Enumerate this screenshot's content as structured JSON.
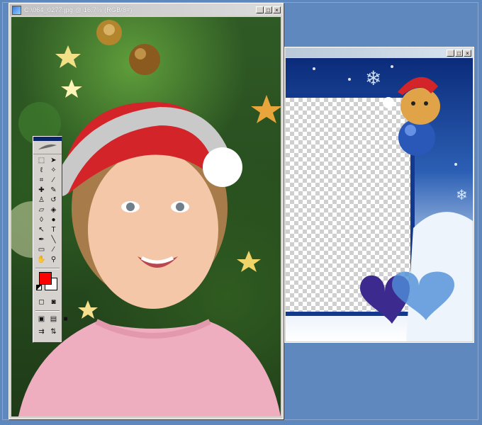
{
  "photo_window": {
    "title": "C:\\064_0277.jpg @ 16.7% (RGB/8#)",
    "buttons": {
      "minimize": "_",
      "maximize": "□",
      "close": "×"
    }
  },
  "frame_window": {
    "buttons": {
      "minimize": "_",
      "maximize": "□",
      "close": "×"
    }
  },
  "toolbox": {
    "tools": [
      {
        "name": "marquee-tool",
        "glyph": "⬚"
      },
      {
        "name": "move-tool",
        "glyph": "➤"
      },
      {
        "name": "lasso-tool",
        "glyph": "ℓ"
      },
      {
        "name": "magic-wand-tool",
        "glyph": "✧"
      },
      {
        "name": "crop-tool",
        "glyph": "⌗"
      },
      {
        "name": "slice-tool",
        "glyph": "∕"
      },
      {
        "name": "healing-brush-tool",
        "glyph": "✚"
      },
      {
        "name": "brush-tool",
        "glyph": "✎"
      },
      {
        "name": "clone-stamp-tool",
        "glyph": "♙"
      },
      {
        "name": "history-brush-tool",
        "glyph": "↺"
      },
      {
        "name": "eraser-tool",
        "glyph": "▱"
      },
      {
        "name": "paint-bucket-tool",
        "glyph": "◈"
      },
      {
        "name": "blur-tool",
        "glyph": "◊"
      },
      {
        "name": "dodge-tool",
        "glyph": "●"
      },
      {
        "name": "path-selection-tool",
        "glyph": "↖"
      },
      {
        "name": "type-tool",
        "glyph": "T"
      },
      {
        "name": "pen-tool",
        "glyph": "✒"
      },
      {
        "name": "line-tool",
        "glyph": "╲"
      },
      {
        "name": "notes-tool",
        "glyph": "▭"
      },
      {
        "name": "eyedropper-tool",
        "glyph": "⁄"
      },
      {
        "name": "hand-tool",
        "glyph": "✋"
      },
      {
        "name": "zoom-tool",
        "glyph": "⚲"
      }
    ],
    "mode_tools": [
      {
        "name": "standard-mode",
        "glyph": "◻"
      },
      {
        "name": "quick-mask-mode",
        "glyph": "◙"
      }
    ],
    "screen_tools": [
      {
        "name": "standard-screen-mode",
        "glyph": "▣"
      },
      {
        "name": "full-screen-menu-mode",
        "glyph": "▤"
      },
      {
        "name": "full-screen-mode",
        "glyph": "■"
      }
    ],
    "jump_tools": [
      {
        "name": "jump-to-imageready",
        "glyph": "⇉"
      },
      {
        "name": "jump-to-imageready-2",
        "glyph": "⇅"
      }
    ],
    "colors": {
      "foreground": "#ff0000",
      "background": "#ffffff"
    }
  }
}
